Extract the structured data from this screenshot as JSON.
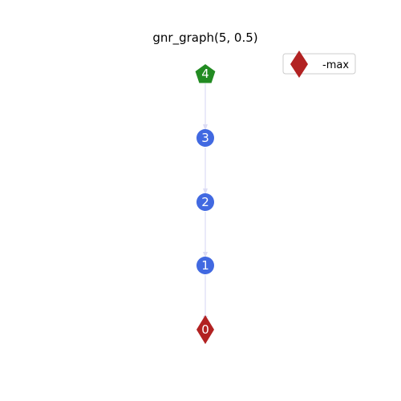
{
  "title": "gnr_graph(5, 0.5)",
  "colors": {
    "edge": "#dcdcf5",
    "default_node": "#4169e1",
    "top_node": "#228b22",
    "max_node": "#b22222",
    "label": "#ffffff"
  },
  "nodes": [
    {
      "id": "4",
      "label": "4",
      "shape": "pentagon",
      "color": "#228b22"
    },
    {
      "id": "3",
      "label": "3",
      "shape": "circle",
      "color": "#4169e1"
    },
    {
      "id": "2",
      "label": "2",
      "shape": "circle",
      "color": "#4169e1"
    },
    {
      "id": "1",
      "label": "1",
      "shape": "circle",
      "color": "#4169e1"
    },
    {
      "id": "0",
      "label": "0",
      "shape": "diamond",
      "color": "#b22222"
    }
  ],
  "edges": [
    {
      "from": "4",
      "to": "3"
    },
    {
      "from": "3",
      "to": "2"
    },
    {
      "from": "2",
      "to": "1"
    },
    {
      "from": "1",
      "to": "0"
    }
  ],
  "legend": {
    "entries": [
      {
        "label": "-max",
        "shape": "diamond",
        "color": "#b22222"
      }
    ]
  }
}
